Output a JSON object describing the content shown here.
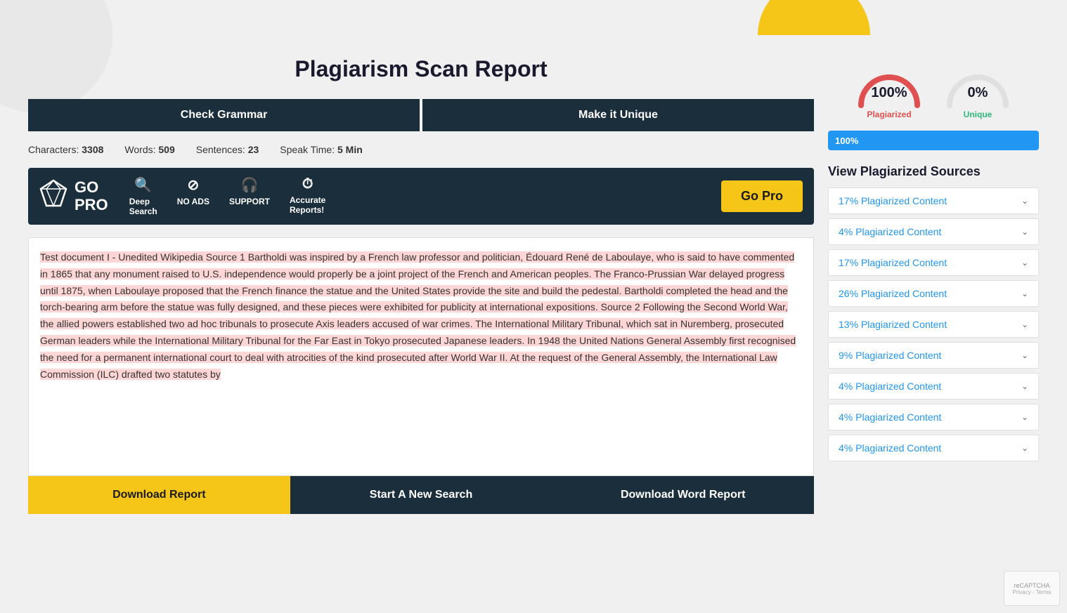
{
  "page": {
    "title": "Plagiarism Scan Report"
  },
  "decorative": {
    "yellow_shape": "decorative yellow arc"
  },
  "action_bar": {
    "check_grammar_label": "Check Grammar",
    "make_unique_label": "Make it Unique"
  },
  "stats": {
    "characters_label": "Characters:",
    "characters_value": "3308",
    "words_label": "Words:",
    "words_value": "509",
    "sentences_label": "Sentences:",
    "sentences_value": "23",
    "speak_time_label": "Speak Time:",
    "speak_time_value": "5 Min"
  },
  "go_pro_banner": {
    "logo_text": "GO\nPRO",
    "features": [
      {
        "icon": "🔍",
        "label": "Deep\nSearch"
      },
      {
        "icon": "⊘",
        "label": "NO ADS"
      },
      {
        "icon": "🎧",
        "label": "SUPPORT"
      },
      {
        "icon": "⏱",
        "label": "Accurate\nReports!"
      }
    ],
    "button_label": "Go Pro"
  },
  "document_text": "Test document I - Unedited Wikipedia Source 1  Bartholdi was inspired by a French law professor and politician, Édouard René de Laboulaye, who is said to have commented in 1865 that any monument raised to U.S.   independence would properly be a joint project of the French and American peoples.   The Franco-Prussian War delayed progress until 1875, when Laboulaye proposed that the French finance the statue and the United States provide the site and build the pedestal.   Bartholdi completed the head and the torch-bearing arm before the statue was fully designed, and these pieces were exhibited for publicity at international expositions.  Source 2  Following the Second World War, the allied powers established two ad hoc tribunals to prosecute Axis leaders accused of war crimes.   The International Military Tribunal, which sat in Nuremberg, prosecuted German leaders while the International Military Tribunal for the Far East in Tokyo prosecuted Japanese leaders.   In 1948 the United Nations General Assembly first recognised the need for a permanent international court to deal with atrocities of the kind prosecuted after World War II.  At the request of the General Assembly, the International Law Commission (ILC) drafted two statutes by",
  "bottom_buttons": {
    "download_report": "Download Report",
    "start_new_search": "Start A New Search",
    "download_word_report": "Download Word Report"
  },
  "sidebar": {
    "plagiarized_percent": "100%",
    "plagiarized_label": "Plagiarized",
    "unique_percent": "0%",
    "unique_label": "Unique",
    "progress_value": "100%",
    "sources_title": "View Plagiarized Sources",
    "sources": [
      "17% Plagiarized Content",
      "4% Plagiarized Content",
      "17% Plagiarized Content",
      "26% Plagiarized Content",
      "13% Plagiarized Content",
      "9% Plagiarized Content",
      "4% Plagiarized Content",
      "4% Plagiarized Content",
      "4% Plagiarized Content"
    ]
  },
  "recaptcha": {
    "line1": "Privacy - Terms"
  }
}
